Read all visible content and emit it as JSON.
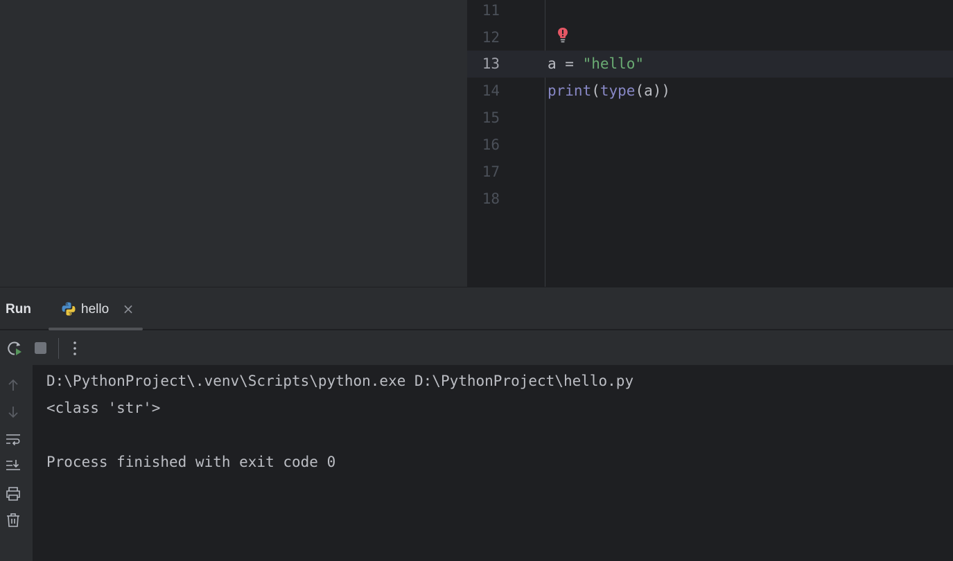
{
  "editor": {
    "lines": [
      {
        "number": "11",
        "tokens": []
      },
      {
        "number": "12",
        "tokens": []
      },
      {
        "number": "13",
        "tokens": [
          {
            "text": "a = ",
            "kind": "plain"
          },
          {
            "text": "\"hello\"",
            "kind": "str"
          }
        ]
      },
      {
        "number": "14",
        "tokens": [
          {
            "text": "print",
            "kind": "builtin"
          },
          {
            "text": "(",
            "kind": "plain"
          },
          {
            "text": "type",
            "kind": "builtin"
          },
          {
            "text": "(a))",
            "kind": "plain"
          }
        ]
      },
      {
        "number": "15",
        "tokens": []
      },
      {
        "number": "16",
        "tokens": []
      },
      {
        "number": "17",
        "tokens": []
      },
      {
        "number": "18",
        "tokens": []
      }
    ],
    "current_line": "13",
    "gutter_icon": "error-lightbulb-icon"
  },
  "run_panel": {
    "title": "Run",
    "tab": {
      "label": "hello",
      "icon": "python-icon",
      "close_icon": "close-icon"
    },
    "toolbar": {
      "rerun_icon": "rerun-icon",
      "stop_icon": "stop-icon",
      "more_icon": "more-vertical-icon"
    },
    "side_tools": [
      "scroll-up-icon",
      "scroll-down-icon",
      "soft-wrap-icon",
      "scroll-to-end-icon",
      "print-icon",
      "trash-icon"
    ],
    "console_lines": [
      "D:\\PythonProject\\.venv\\Scripts\\python.exe D:\\PythonProject\\hello.py",
      "<class 'str'>",
      "",
      "Process finished with exit code 0"
    ]
  },
  "colors": {
    "string": "#6aab73",
    "builtin": "#8888c6",
    "text": "#bcbec4",
    "error": "#e55765"
  }
}
